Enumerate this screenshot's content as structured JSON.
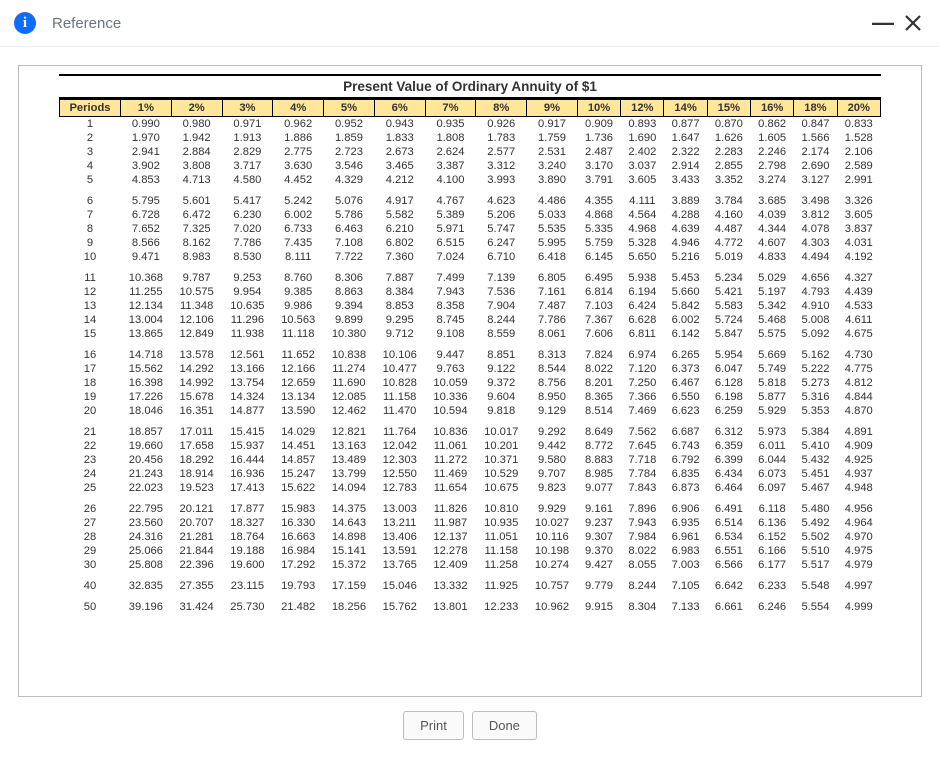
{
  "header": {
    "title": "Reference",
    "info_icon_glyph": "i",
    "minimize_glyph": "—"
  },
  "footer": {
    "print_label": "Print",
    "done_label": "Done"
  },
  "chart_data": {
    "type": "table",
    "title": "Present Value of Ordinary Annuity of $1",
    "periods_header": "Periods",
    "rate_headers": [
      "1%",
      "2%",
      "3%",
      "4%",
      "5%",
      "6%",
      "7%",
      "8%",
      "9%",
      "10%",
      "12%",
      "14%",
      "15%",
      "16%",
      "18%",
      "20%"
    ],
    "groups": [
      {
        "rows": [
          {
            "p": "1",
            "v": [
              "0.990",
              "0.980",
              "0.971",
              "0.962",
              "0.952",
              "0.943",
              "0.935",
              "0.926",
              "0.917",
              "0.909",
              "0.893",
              "0.877",
              "0.870",
              "0.862",
              "0.847",
              "0.833"
            ]
          },
          {
            "p": "2",
            "v": [
              "1.970",
              "1.942",
              "1.913",
              "1.886",
              "1.859",
              "1.833",
              "1.808",
              "1.783",
              "1.759",
              "1.736",
              "1.690",
              "1.647",
              "1.626",
              "1.605",
              "1.566",
              "1.528"
            ]
          },
          {
            "p": "3",
            "v": [
              "2.941",
              "2.884",
              "2.829",
              "2.775",
              "2.723",
              "2.673",
              "2.624",
              "2.577",
              "2.531",
              "2.487",
              "2.402",
              "2.322",
              "2.283",
              "2.246",
              "2.174",
              "2.106"
            ]
          },
          {
            "p": "4",
            "v": [
              "3.902",
              "3.808",
              "3.717",
              "3.630",
              "3.546",
              "3.465",
              "3.387",
              "3.312",
              "3.240",
              "3.170",
              "3.037",
              "2.914",
              "2.855",
              "2.798",
              "2.690",
              "2.589"
            ]
          },
          {
            "p": "5",
            "v": [
              "4.853",
              "4.713",
              "4.580",
              "4.452",
              "4.329",
              "4.212",
              "4.100",
              "3.993",
              "3.890",
              "3.791",
              "3.605",
              "3.433",
              "3.352",
              "3.274",
              "3.127",
              "2.991"
            ]
          }
        ]
      },
      {
        "rows": [
          {
            "p": "6",
            "v": [
              "5.795",
              "5.601",
              "5.417",
              "5.242",
              "5.076",
              "4.917",
              "4.767",
              "4.623",
              "4.486",
              "4.355",
              "4.111",
              "3.889",
              "3.784",
              "3.685",
              "3.498",
              "3.326"
            ]
          },
          {
            "p": "7",
            "v": [
              "6.728",
              "6.472",
              "6.230",
              "6.002",
              "5.786",
              "5.582",
              "5.389",
              "5.206",
              "5.033",
              "4.868",
              "4.564",
              "4.288",
              "4.160",
              "4.039",
              "3.812",
              "3.605"
            ]
          },
          {
            "p": "8",
            "v": [
              "7.652",
              "7.325",
              "7.020",
              "6.733",
              "6.463",
              "6.210",
              "5.971",
              "5.747",
              "5.535",
              "5.335",
              "4.968",
              "4.639",
              "4.487",
              "4.344",
              "4.078",
              "3.837"
            ]
          },
          {
            "p": "9",
            "v": [
              "8.566",
              "8.162",
              "7.786",
              "7.435",
              "7.108",
              "6.802",
              "6.515",
              "6.247",
              "5.995",
              "5.759",
              "5.328",
              "4.946",
              "4.772",
              "4.607",
              "4.303",
              "4.031"
            ]
          },
          {
            "p": "10",
            "v": [
              "9.471",
              "8.983",
              "8.530",
              "8.111",
              "7.722",
              "7.360",
              "7.024",
              "6.710",
              "6.418",
              "6.145",
              "5.650",
              "5.216",
              "5.019",
              "4.833",
              "4.494",
              "4.192"
            ]
          }
        ]
      },
      {
        "rows": [
          {
            "p": "11",
            "v": [
              "10.368",
              "9.787",
              "9.253",
              "8.760",
              "8.306",
              "7.887",
              "7.499",
              "7.139",
              "6.805",
              "6.495",
              "5.938",
              "5.453",
              "5.234",
              "5.029",
              "4.656",
              "4.327"
            ]
          },
          {
            "p": "12",
            "v": [
              "11.255",
              "10.575",
              "9.954",
              "9.385",
              "8.863",
              "8.384",
              "7.943",
              "7.536",
              "7.161",
              "6.814",
              "6.194",
              "5.660",
              "5.421",
              "5.197",
              "4.793",
              "4.439"
            ]
          },
          {
            "p": "13",
            "v": [
              "12.134",
              "11.348",
              "10.635",
              "9.986",
              "9.394",
              "8.853",
              "8.358",
              "7.904",
              "7.487",
              "7.103",
              "6.424",
              "5.842",
              "5.583",
              "5.342",
              "4.910",
              "4.533"
            ]
          },
          {
            "p": "14",
            "v": [
              "13.004",
              "12.106",
              "11.296",
              "10.563",
              "9.899",
              "9.295",
              "8.745",
              "8.244",
              "7.786",
              "7.367",
              "6.628",
              "6.002",
              "5.724",
              "5.468",
              "5.008",
              "4.611"
            ]
          },
          {
            "p": "15",
            "v": [
              "13.865",
              "12.849",
              "11.938",
              "11.118",
              "10.380",
              "9.712",
              "9.108",
              "8.559",
              "8.061",
              "7.606",
              "6.811",
              "6.142",
              "5.847",
              "5.575",
              "5.092",
              "4.675"
            ]
          }
        ]
      },
      {
        "rows": [
          {
            "p": "16",
            "v": [
              "14.718",
              "13.578",
              "12.561",
              "11.652",
              "10.838",
              "10.106",
              "9.447",
              "8.851",
              "8.313",
              "7.824",
              "6.974",
              "6.265",
              "5.954",
              "5.669",
              "5.162",
              "4.730"
            ]
          },
          {
            "p": "17",
            "v": [
              "15.562",
              "14.292",
              "13.166",
              "12.166",
              "11.274",
              "10.477",
              "9.763",
              "9.122",
              "8.544",
              "8.022",
              "7.120",
              "6.373",
              "6.047",
              "5.749",
              "5.222",
              "4.775"
            ]
          },
          {
            "p": "18",
            "v": [
              "16.398",
              "14.992",
              "13.754",
              "12.659",
              "11.690",
              "10.828",
              "10.059",
              "9.372",
              "8.756",
              "8.201",
              "7.250",
              "6.467",
              "6.128",
              "5.818",
              "5.273",
              "4.812"
            ]
          },
          {
            "p": "19",
            "v": [
              "17.226",
              "15.678",
              "14.324",
              "13.134",
              "12.085",
              "11.158",
              "10.336",
              "9.604",
              "8.950",
              "8.365",
              "7.366",
              "6.550",
              "6.198",
              "5.877",
              "5.316",
              "4.844"
            ]
          },
          {
            "p": "20",
            "v": [
              "18.046",
              "16.351",
              "14.877",
              "13.590",
              "12.462",
              "11.470",
              "10.594",
              "9.818",
              "9.129",
              "8.514",
              "7.469",
              "6.623",
              "6.259",
              "5.929",
              "5.353",
              "4.870"
            ]
          }
        ]
      },
      {
        "rows": [
          {
            "p": "21",
            "v": [
              "18.857",
              "17.011",
              "15.415",
              "14.029",
              "12.821",
              "11.764",
              "10.836",
              "10.017",
              "9.292",
              "8.649",
              "7.562",
              "6.687",
              "6.312",
              "5.973",
              "5.384",
              "4.891"
            ]
          },
          {
            "p": "22",
            "v": [
              "19.660",
              "17.658",
              "15.937",
              "14.451",
              "13.163",
              "12.042",
              "11.061",
              "10.201",
              "9.442",
              "8.772",
              "7.645",
              "6.743",
              "6.359",
              "6.011",
              "5.410",
              "4.909"
            ]
          },
          {
            "p": "23",
            "v": [
              "20.456",
              "18.292",
              "16.444",
              "14.857",
              "13.489",
              "12.303",
              "11.272",
              "10.371",
              "9.580",
              "8.883",
              "7.718",
              "6.792",
              "6.399",
              "6.044",
              "5.432",
              "4.925"
            ]
          },
          {
            "p": "24",
            "v": [
              "21.243",
              "18.914",
              "16.936",
              "15.247",
              "13.799",
              "12.550",
              "11.469",
              "10.529",
              "9.707",
              "8.985",
              "7.784",
              "6.835",
              "6.434",
              "6.073",
              "5.451",
              "4.937"
            ]
          },
          {
            "p": "25",
            "v": [
              "22.023",
              "19.523",
              "17.413",
              "15.622",
              "14.094",
              "12.783",
              "11.654",
              "10.675",
              "9.823",
              "9.077",
              "7.843",
              "6.873",
              "6.464",
              "6.097",
              "5.467",
              "4.948"
            ]
          }
        ]
      },
      {
        "rows": [
          {
            "p": "26",
            "v": [
              "22.795",
              "20.121",
              "17.877",
              "15.983",
              "14.375",
              "13.003",
              "11.826",
              "10.810",
              "9.929",
              "9.161",
              "7.896",
              "6.906",
              "6.491",
              "6.118",
              "5.480",
              "4.956"
            ]
          },
          {
            "p": "27",
            "v": [
              "23.560",
              "20.707",
              "18.327",
              "16.330",
              "14.643",
              "13.211",
              "11.987",
              "10.935",
              "10.027",
              "9.237",
              "7.943",
              "6.935",
              "6.514",
              "6.136",
              "5.492",
              "4.964"
            ]
          },
          {
            "p": "28",
            "v": [
              "24.316",
              "21.281",
              "18.764",
              "16.663",
              "14.898",
              "13.406",
              "12.137",
              "11.051",
              "10.116",
              "9.307",
              "7.984",
              "6.961",
              "6.534",
              "6.152",
              "5.502",
              "4.970"
            ]
          },
          {
            "p": "29",
            "v": [
              "25.066",
              "21.844",
              "19.188",
              "16.984",
              "15.141",
              "13.591",
              "12.278",
              "11.158",
              "10.198",
              "9.370",
              "8.022",
              "6.983",
              "6.551",
              "6.166",
              "5.510",
              "4.975"
            ]
          },
          {
            "p": "30",
            "v": [
              "25.808",
              "22.396",
              "19.600",
              "17.292",
              "15.372",
              "13.765",
              "12.409",
              "11.258",
              "10.274",
              "9.427",
              "8.055",
              "7.003",
              "6.566",
              "6.177",
              "5.517",
              "4.979"
            ]
          }
        ]
      },
      {
        "rows": [
          {
            "p": "40",
            "v": [
              "32.835",
              "27.355",
              "23.115",
              "19.793",
              "17.159",
              "15.046",
              "13.332",
              "11.925",
              "10.757",
              "9.779",
              "8.244",
              "7.105",
              "6.642",
              "6.233",
              "5.548",
              "4.997"
            ]
          }
        ]
      },
      {
        "rows": [
          {
            "p": "50",
            "v": [
              "39.196",
              "31.424",
              "25.730",
              "21.482",
              "18.256",
              "15.762",
              "13.801",
              "12.233",
              "10.962",
              "9.915",
              "8.304",
              "7.133",
              "6.661",
              "6.246",
              "5.554",
              "4.999"
            ]
          }
        ]
      }
    ]
  }
}
